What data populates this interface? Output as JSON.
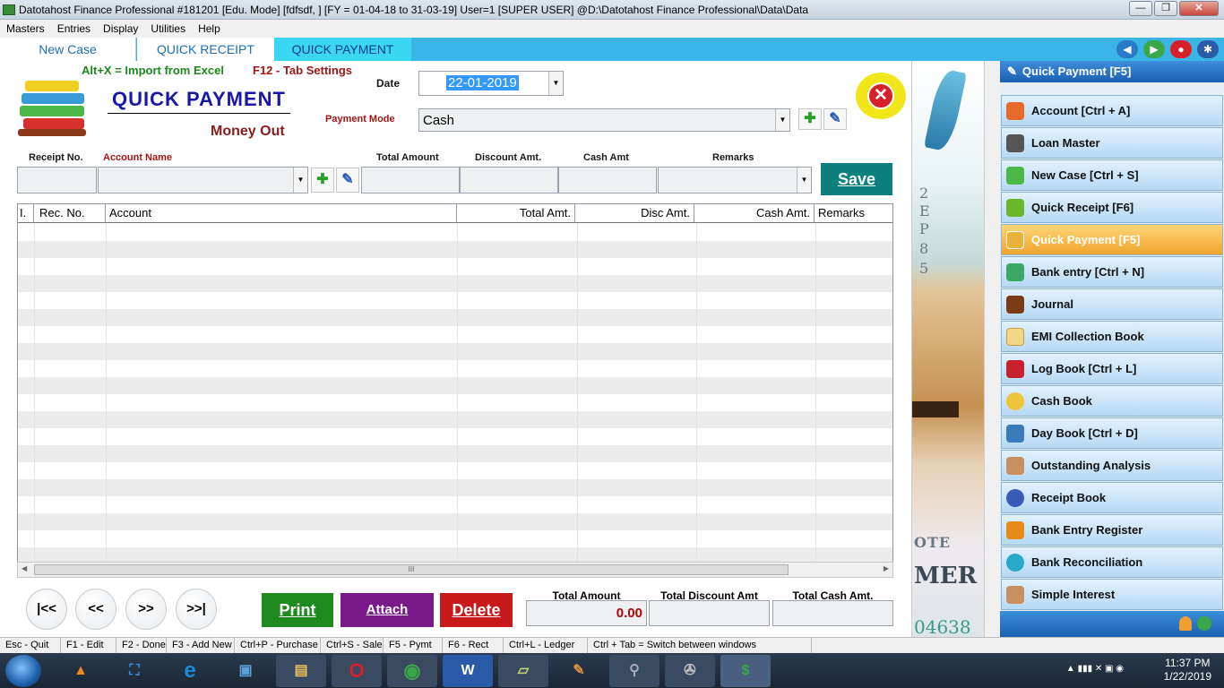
{
  "window": {
    "title": "Datotahost Finance Professional #181201  [Edu. Mode]  [fdfsdf, ]  [FY = 01-04-18 to 31-03-19]  User=1 [SUPER USER]  @D:\\Datotahost Finance Professional\\Data\\Data",
    "minimize": "—",
    "maximize": "❐",
    "close": "✕"
  },
  "menu": [
    "Masters",
    "Entries",
    "Display",
    "Utilities",
    "Help"
  ],
  "tabs": [
    "New Case",
    "QUICK RECEIPT",
    "QUICK PAYMENT"
  ],
  "form": {
    "hint_import": "Alt+X =  Import from Excel",
    "hint_settings": "F12 - Tab Settings",
    "title": "QUICK PAYMENT",
    "subtitle": "Money Out",
    "date_label": "Date",
    "date_value": "22-01-2019",
    "payment_mode_label": "Payment Mode",
    "payment_mode_value": "Cash",
    "receipt_no_label": "Receipt No.",
    "account_name_label": "Account Name",
    "total_amount_label": "Total Amount",
    "discount_amt_label": "Discount Amt.",
    "cash_amt_label": "Cash Amt",
    "remarks_label": "Remarks",
    "save_label": "Save",
    "add_glyph": "✚",
    "edit_glyph": "✎",
    "close_glyph": "✕"
  },
  "grid": {
    "columns": [
      "I.",
      "Rec. No.",
      "Account",
      "Total Amt.",
      "Disc Amt.",
      "Cash Amt.",
      "Remarks"
    ],
    "rows": [],
    "scroll_grip": "III"
  },
  "nav": {
    "first": "|<<",
    "prev": "<<",
    "next": ">>",
    "last": ">>|"
  },
  "actions": {
    "print": "Print",
    "attach": "Attach",
    "delete": "Delete"
  },
  "totals": {
    "total_amount_label": "Total Amount",
    "total_amount_value": "0.00",
    "total_discount_label": "Total Discount Amt",
    "total_discount_value": "",
    "total_cash_label": "Total Cash Amt.",
    "total_cash_value": ""
  },
  "strip_text": [
    "2",
    "E",
    "P",
    "8",
    "5",
    "OTE",
    "MER",
    "04638"
  ],
  "sidebar": {
    "header": "Quick Payment [F5]",
    "items": [
      {
        "label": "Account [Ctrl + A]",
        "icon": "account-icon",
        "color": "#e86a2b"
      },
      {
        "label": "Loan Master",
        "icon": "loan-icon",
        "color": "#555555"
      },
      {
        "label": "New Case [Ctrl + S]",
        "icon": "new-case-icon",
        "color": "#4cb848"
      },
      {
        "label": "Quick Receipt [F6]",
        "icon": "receipt-icon",
        "color": "#6ab82a"
      },
      {
        "label": "Quick Payment [F5]",
        "icon": "payment-icon",
        "color": "#e8b23a"
      },
      {
        "label": "Bank entry [Ctrl + N]",
        "icon": "bank-entry-icon",
        "color": "#3ca868"
      },
      {
        "label": "Journal",
        "icon": "journal-icon",
        "color": "#7a3b14"
      },
      {
        "label": "EMI Collection Book",
        "icon": "emi-icon",
        "color": "#f3d68a"
      },
      {
        "label": "Log Book [Ctrl + L]",
        "icon": "log-book-icon",
        "color": "#c8202c"
      },
      {
        "label": "Cash Book",
        "icon": "cash-book-icon",
        "color": "#f0c43a"
      },
      {
        "label": "Day Book [Ctrl + D]",
        "icon": "day-book-icon",
        "color": "#3a7ab8"
      },
      {
        "label": "Outstanding Analysis",
        "icon": "outstanding-icon",
        "color": "#c89060"
      },
      {
        "label": "Receipt Book",
        "icon": "receipt-book-icon",
        "color": "#3a5ab8"
      },
      {
        "label": "Bank Entry Register",
        "icon": "bank-register-icon",
        "color": "#e88a1a"
      },
      {
        "label": "Bank Reconciliation",
        "icon": "reconciliation-icon",
        "color": "#2aa8c8"
      },
      {
        "label": "Simple Interest",
        "icon": "interest-icon",
        "color": "#c89060"
      }
    ],
    "active_index": 4
  },
  "statusbar": [
    "Esc - Quit",
    "F1 - Edit",
    "F2 - Done",
    "F3 - Add New",
    "Ctrl+P - Purchase",
    "Ctrl+S - Sale",
    "F5 - Pymt",
    "F6 - Rect",
    "Ctrl+L - Ledger",
    "Ctrl + Tab = Switch between windows"
  ],
  "taskbar": {
    "apps": [
      {
        "name": "vlc-icon",
        "glyph": "▲",
        "color": "#f08a1c"
      },
      {
        "name": "screenshot-icon",
        "glyph": "⛶",
        "color": "#3a8ad8"
      },
      {
        "name": "ie-icon",
        "glyph": "e",
        "color": "#1a8ad8"
      },
      {
        "name": "control-panel-icon",
        "glyph": "▣",
        "color": "#5aa0d8"
      },
      {
        "name": "explorer-icon",
        "glyph": "▤",
        "color": "#e8c060"
      },
      {
        "name": "opera-icon",
        "glyph": "O",
        "color": "#d8202c"
      },
      {
        "name": "chrome-icon",
        "glyph": "◉",
        "color": "#3aa848"
      },
      {
        "name": "word-icon",
        "glyph": "W",
        "color": "#2a5aa8"
      },
      {
        "name": "notes-icon",
        "glyph": "▱",
        "color": "#c8d870"
      },
      {
        "name": "paint-icon",
        "glyph": "✎",
        "color": "#d89040"
      },
      {
        "name": "search-tool-icon",
        "glyph": "⚲",
        "color": "#a8a8c8"
      },
      {
        "name": "media-icon",
        "glyph": "✇",
        "color": "#a0a0a0"
      },
      {
        "name": "finance-app-icon",
        "glyph": "$",
        "color": "#3aa848"
      }
    ],
    "time": "11:37 PM",
    "date": "1/22/2019"
  }
}
